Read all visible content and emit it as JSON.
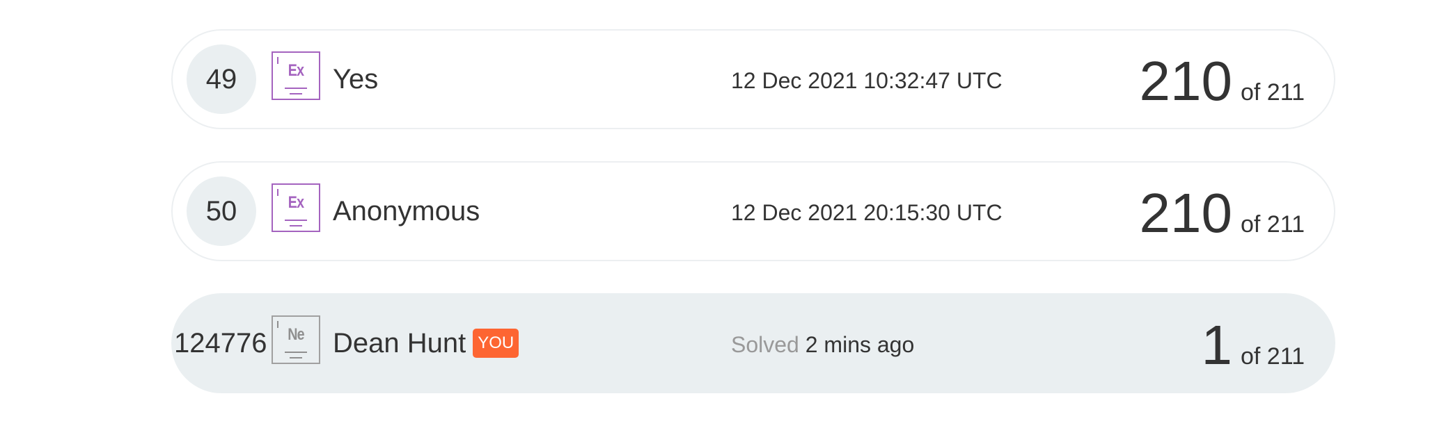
{
  "leaderboard": {
    "rows": [
      {
        "rank": "49",
        "level_abbr": "Ex",
        "username": "Yes",
        "time": "12 Dec 2021 10:32:47 UTC",
        "score": "210",
        "of_total": "of 211"
      },
      {
        "rank": "50",
        "level_abbr": "Ex",
        "username": "Anonymous",
        "time": "12 Dec 2021 20:15:30 UTC",
        "score": "210",
        "of_total": "of 211"
      }
    ],
    "current_user": {
      "rank": "124776",
      "level_abbr": "Ne",
      "username": "Dean Hunt",
      "badge": "YOU",
      "time_prefix": "Solved",
      "time_value": "2 mins ago",
      "score": "1",
      "of_total": "of 211"
    }
  },
  "colors": {
    "row_border": "#eceff1",
    "rank_circle": "#eaeff1",
    "highlight_row": "#eaeff1",
    "expert_level": "#a463bf",
    "newbie_level": "#a0a0a0",
    "you_badge": "#fd6532",
    "text": "#333333",
    "muted_text": "#999999"
  },
  "icons": {
    "level_expert": "element-tile-icon",
    "level_newbie": "element-tile-icon"
  }
}
